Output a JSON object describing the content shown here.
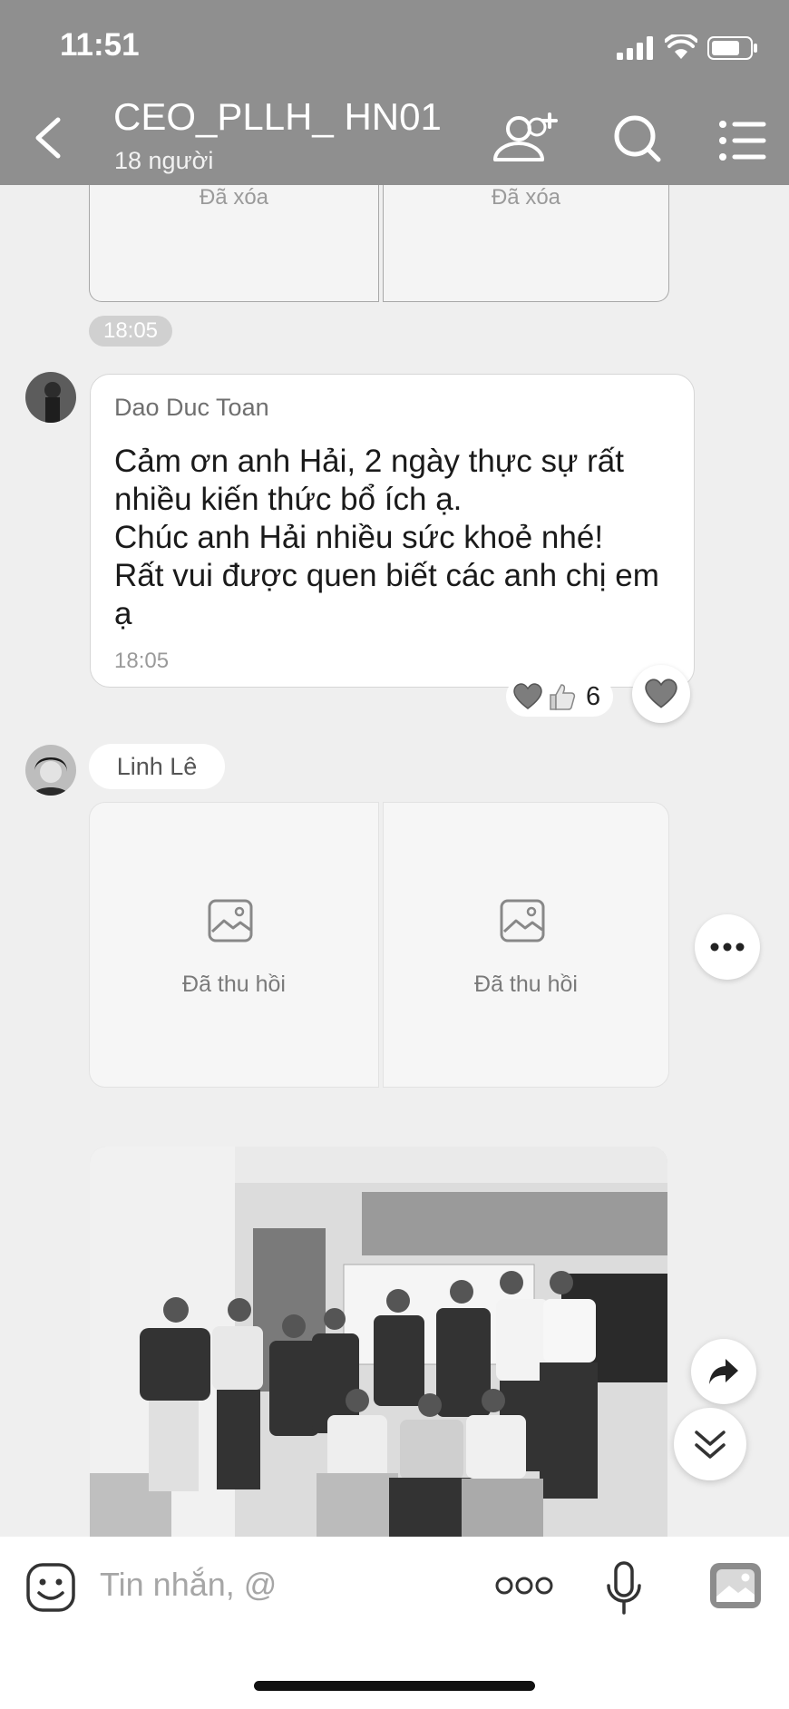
{
  "status_bar": {
    "time": "11:51"
  },
  "header": {
    "title": "CEO_PLLH_ HN01",
    "members": "18 người"
  },
  "old_images": [
    {
      "label": "Đã xóa"
    },
    {
      "label": "Đã xóa"
    }
  ],
  "time_separator": "18:05",
  "message": {
    "sender": "Dao Duc Toan",
    "text": "Cảm ơn anh Hải, 2 ngày thực sự rất\nnhiều kiến thức bổ ích ạ.\nChúc anh Hải nhiều sức khoẻ nhé!\nRất vui được quen biết các anh chị em\nạ",
    "time": "18:05",
    "reaction_count": "6"
  },
  "next_sender": {
    "name": "Linh Lê"
  },
  "recalled_images": [
    {
      "label": "Đã thu hồi"
    },
    {
      "label": "Đã thu hồi"
    }
  ],
  "composer": {
    "placeholder": "Tin nhắn, @"
  }
}
